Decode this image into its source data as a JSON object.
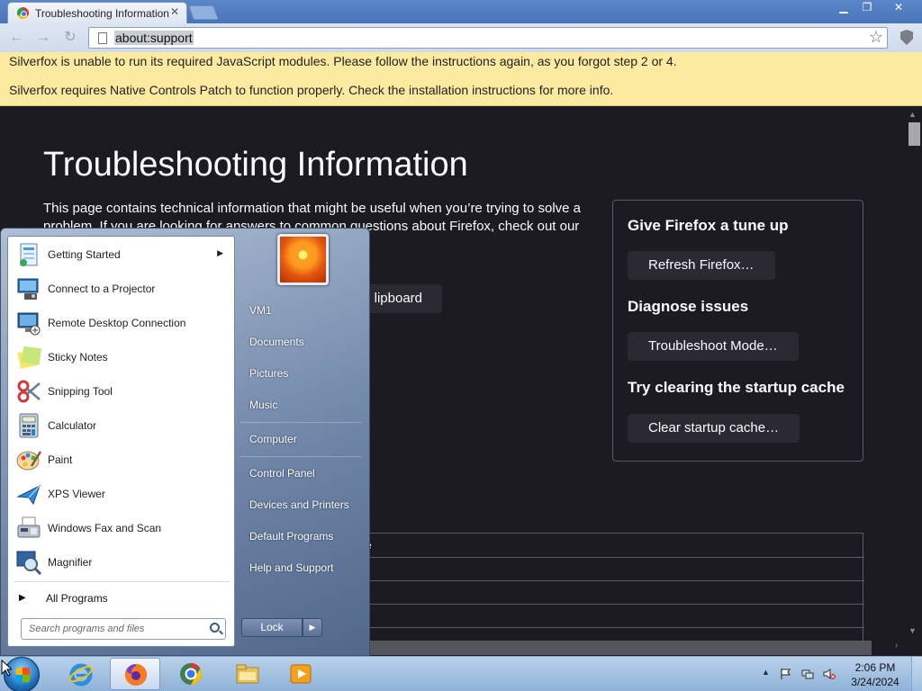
{
  "browser": {
    "tab_title": "Troubleshooting Information",
    "url": "about:support"
  },
  "notice": {
    "line1": "Silverfox is unable to run its required JavaScript modules. Please follow the instructions again, as you forgot step 2 or 4.",
    "line2": "Silverfox requires Native Controls Patch to function properly. Check the installation instructions for more info."
  },
  "page": {
    "title": "Troubleshooting Information",
    "intro": "This page contains technical information that might be useful when you’re trying to solve a problem. If you are looking for answers to common questions about Firefox, check out our",
    "copy_button": "lipboard",
    "table_fragment": "e"
  },
  "sidebox": {
    "tuneup_heading": "Give Firefox a tune up",
    "refresh_button": "Refresh Firefox…",
    "diagnose_heading": "Diagnose issues",
    "troubleshoot_button": "Troubleshoot Mode…",
    "cache_heading": "Try clearing the startup cache",
    "cache_button": "Clear startup cache…"
  },
  "start_menu": {
    "programs": [
      {
        "label": "Getting Started",
        "icon": "getting-started-icon"
      },
      {
        "label": "Connect to a Projector",
        "icon": "projector-icon"
      },
      {
        "label": "Remote Desktop Connection",
        "icon": "remote-desktop-icon"
      },
      {
        "label": "Sticky Notes",
        "icon": "sticky-notes-icon"
      },
      {
        "label": "Snipping Tool",
        "icon": "scissors-icon"
      },
      {
        "label": "Calculator",
        "icon": "calculator-icon"
      },
      {
        "label": "Paint",
        "icon": "paint-palette-icon"
      },
      {
        "label": "XPS Viewer",
        "icon": "xps-viewer-icon"
      },
      {
        "label": "Windows Fax and Scan",
        "icon": "fax-icon"
      },
      {
        "label": "Magnifier",
        "icon": "magnifier-icon"
      }
    ],
    "all_programs": "All Programs",
    "search_placeholder": "Search programs and files",
    "right_items": [
      "VM1",
      "Documents",
      "Pictures",
      "Music",
      "Computer",
      "Control Panel",
      "Devices and Printers",
      "Default Programs",
      "Help and Support"
    ],
    "lock_button": "Lock"
  },
  "taskbar": {
    "apps": [
      "start-orb-icon",
      "internet-explorer-icon",
      "firefox-icon",
      "chrome-icon",
      "file-explorer-icon",
      "media-player-icon"
    ],
    "time": "2:06 PM",
    "date": "3/24/2024"
  }
}
